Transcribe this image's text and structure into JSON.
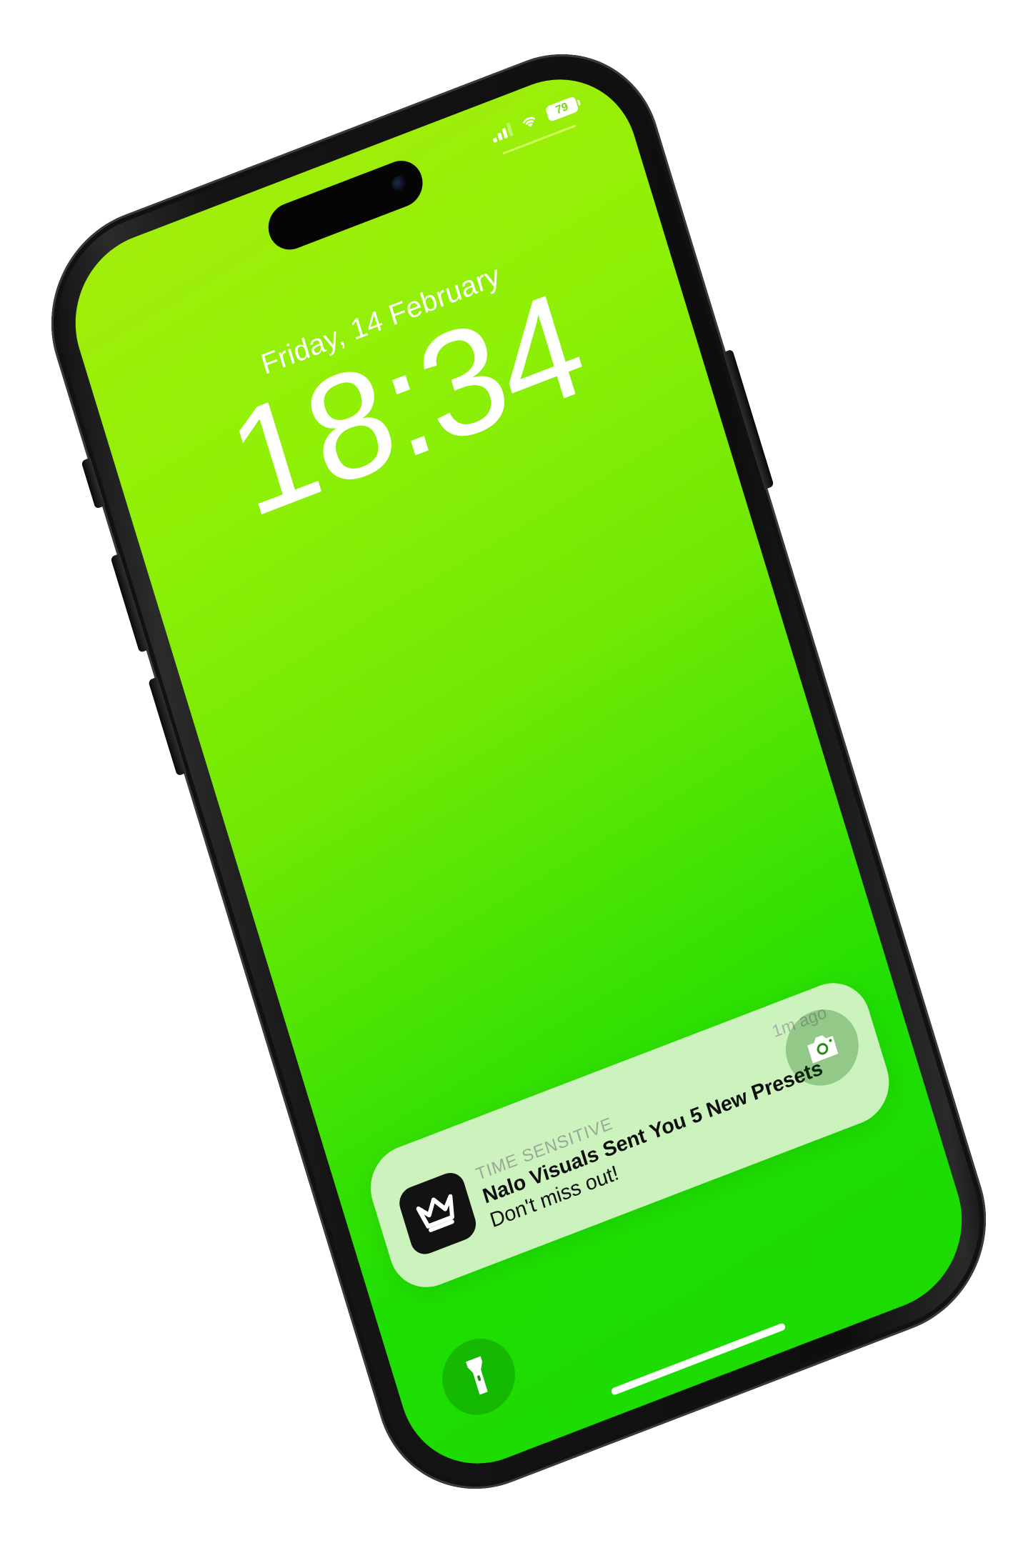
{
  "lockscreen": {
    "date": "Friday, 14 February",
    "time": "18:34"
  },
  "status": {
    "battery": "79",
    "signal_bars": 3,
    "wifi": "wifi-icon"
  },
  "notification": {
    "tag": "TIME SENSITIVE",
    "title": "Nalo Visuals Sent You 5 New Presets",
    "message": "Don't miss out!",
    "time_ago": "1m ago",
    "app_icon": "crown-icon"
  },
  "actions": {
    "left": "flashlight-icon",
    "right": "camera-icon"
  },
  "colors": {
    "screen_top": "#a2ee0b",
    "screen_bottom": "#1ddb02",
    "frame": "#111111",
    "notification_bg": "#e8f5dc"
  }
}
